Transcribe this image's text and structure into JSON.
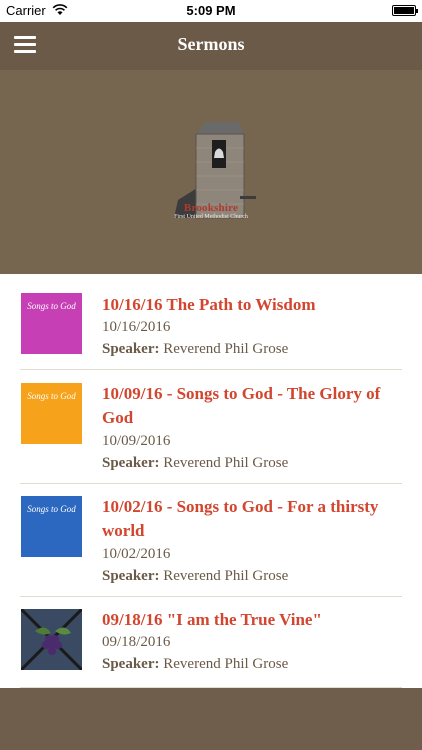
{
  "status_bar": {
    "carrier": "Carrier",
    "time": "5:09 PM"
  },
  "nav": {
    "title": "Sermons",
    "menu_icon": "hamburger-icon"
  },
  "header": {
    "logo_icon": "church-bell-tower-logo",
    "brand": "Brookshire",
    "brand_sub": "First United Methodist Church"
  },
  "sermons": [
    {
      "title": "10/16/16 The Path to Wisdom",
      "date": "10/16/2016",
      "speaker_label": "Speaker:",
      "speaker": "Reverend Phil Grose",
      "thumb_text": "Songs to God",
      "thumb_color": "#c63fb4"
    },
    {
      "title": "10/09/16 - Songs to God - The Glory of God",
      "date": "10/09/2016",
      "speaker_label": "Speaker:",
      "speaker": "Reverend Phil Grose",
      "thumb_text": "Songs to God",
      "thumb_color": "#f6a21a"
    },
    {
      "title": "10/02/16 - Songs to God - For a thirsty world",
      "date": "10/02/2016",
      "speaker_label": "Speaker:",
      "speaker": "Reverend Phil Grose",
      "thumb_text": "Songs to God",
      "thumb_color": "#2c67c0"
    },
    {
      "title": "09/18/16 \"I am the True Vine\"",
      "date": "09/18/2016",
      "speaker_label": "Speaker:",
      "speaker": "Reverend Phil Grose",
      "thumb_text": "",
      "thumb_color": "#2f3b50"
    }
  ],
  "colors": {
    "brand_brown": "#6f5e4b",
    "title_red": "#d2452e",
    "meta_brown": "#6a5a47"
  }
}
